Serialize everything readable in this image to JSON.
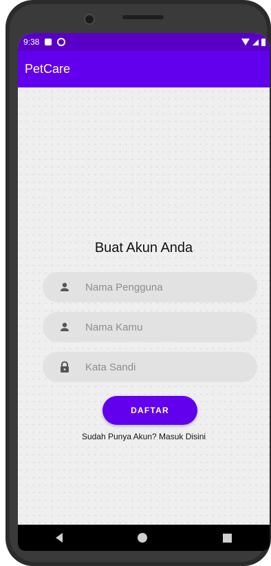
{
  "status_bar": {
    "time": "9:38"
  },
  "app_bar": {
    "title": "PetCare",
    "color": "#6200ee"
  },
  "form": {
    "heading": "Buat Akun Anda",
    "username": {
      "placeholder": "Nama Pengguna",
      "value": "",
      "icon": "person-icon"
    },
    "name": {
      "placeholder": "Nama Kamu",
      "value": "",
      "icon": "person-icon"
    },
    "password": {
      "placeholder": "Kata Sandi",
      "value": "",
      "icon": "lock-icon"
    },
    "submit_label": "DAFTAR",
    "login_link": "Sudah Punya Akun? Masuk Disini"
  },
  "nav_bar": {
    "icons": [
      "back-icon",
      "home-icon",
      "recent-apps-icon"
    ]
  }
}
